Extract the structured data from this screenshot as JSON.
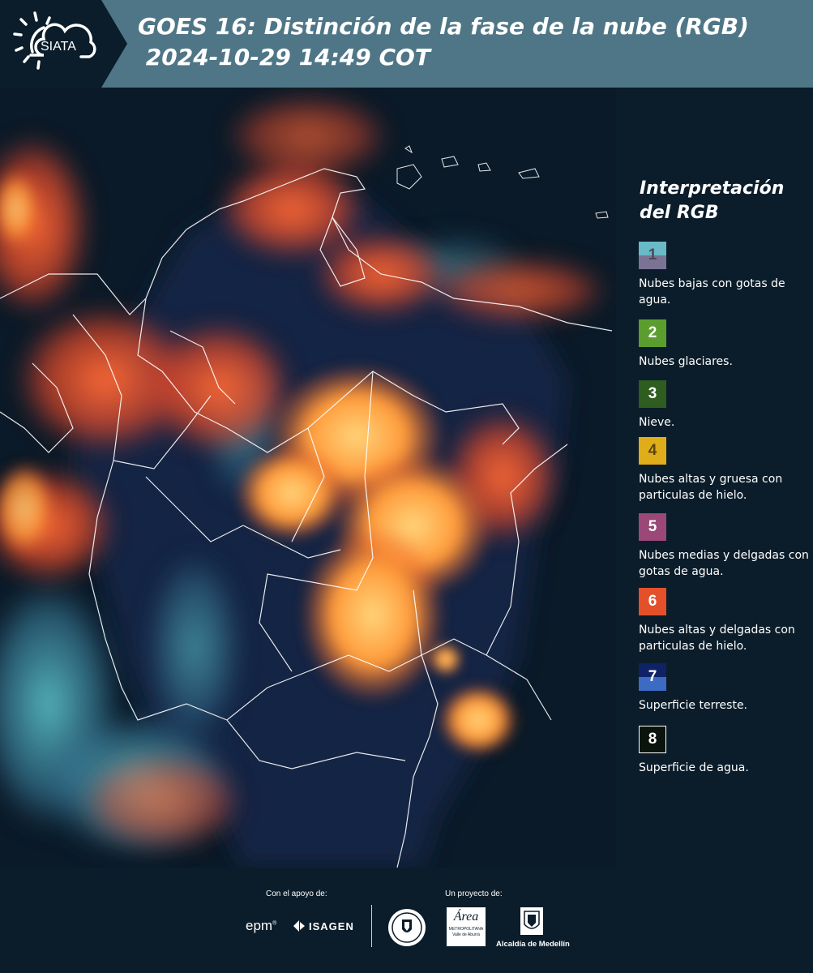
{
  "header": {
    "title_line1": "GOES 16: Distinción de la fase de la nube (RGB)",
    "title_line2": " 2024-10-29 14:49 COT",
    "logo_text": "SIATA",
    "logo_icon": "sun-cloud-icon"
  },
  "legend": {
    "title_line1": "Interpretación",
    "title_line2": "del RGB",
    "items": [
      {
        "number": "1",
        "label": "Nubes bajas con gotas de agua.",
        "color_top": "#6ab9c7",
        "color_bottom": "#7a7394"
      },
      {
        "number": "2",
        "label": "Nubes glaciares.",
        "color": "#5b9e2e"
      },
      {
        "number": "3",
        "label": "Nieve.",
        "color": "#2f5d1f"
      },
      {
        "number": "4",
        "label": "Nubes altas y gruesa con particulas de hielo.",
        "color": "#e0ad1a"
      },
      {
        "number": "5",
        "label": "Nubes medias y delgadas con gotas de agua.",
        "color": "#9b4878"
      },
      {
        "number": "6",
        "label": "Nubes altas y delgadas con particulas de hielo.",
        "color": "#e4502a"
      },
      {
        "number": "7",
        "label": "Superficie terreste.",
        "color_top": "#102267",
        "color_bottom": "#3c6bc4"
      },
      {
        "number": "8",
        "label": "Superficie de agua.",
        "color": "#0a140d"
      }
    ]
  },
  "footer": {
    "support_label": "Con el apoyo de:",
    "project_label": "Un proyecto de:",
    "sponsor_epm": "epm",
    "sponsor_isagen": "ISAGEN",
    "partner_area": "Área",
    "partner_area_sub": "METROPOLITANA",
    "partner_area_sub2": "Valle de Aburrá",
    "partner_alcaldia": "Alcaldía de Medellín"
  }
}
